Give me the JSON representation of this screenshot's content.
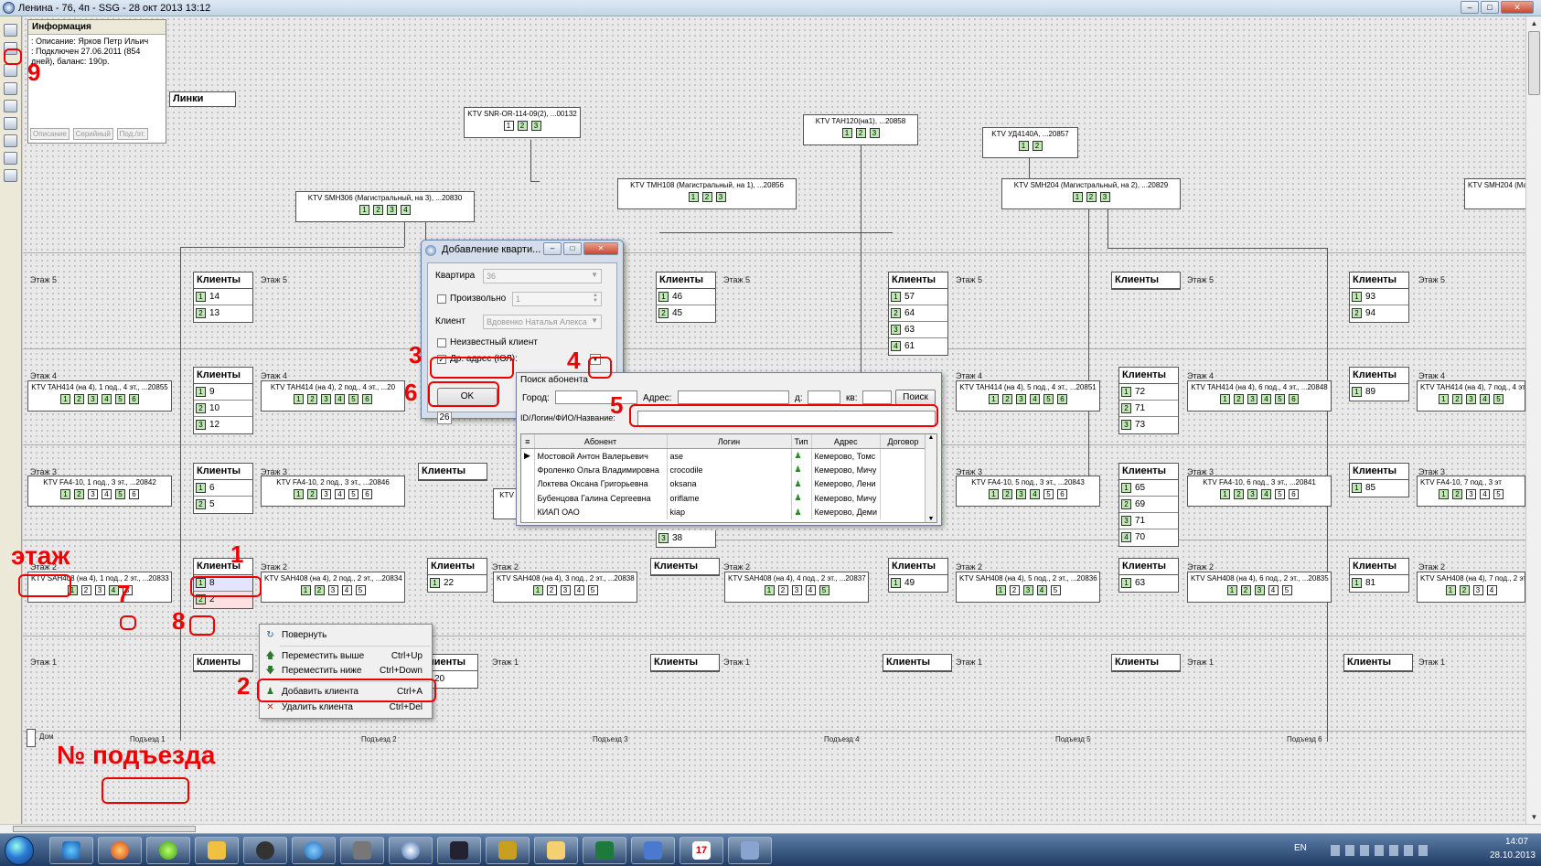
{
  "window": {
    "title": "Ленина - 76, 4п - SSG - 28 окт 2013 13:12"
  },
  "info_panel": {
    "title": "Информация",
    "lines": [
      ": Описание: Ярков Петр Ильич",
      ": Подключен 27.06.2011 (854",
      "дней), баланс: 190р."
    ],
    "buttons": [
      "Описание",
      "Серийный",
      "Под./эт."
    ]
  },
  "links_label": "Линки",
  "floors": {
    "f5": "Этаж 5",
    "f4": "Этаж 4",
    "f3": "Этаж 3",
    "f2": "Этаж 2",
    "f1": "Этаж 1"
  },
  "clients_header": "Клиенты",
  "home_label": "Дом",
  "entrances": [
    "Подъезд 1",
    "Подъезд 2",
    "Подъезд 3",
    "Подъезд 4",
    "Подъезд 5",
    "Подъезд 6"
  ],
  "main_devices": [
    {
      "label": "KTV SNR-OR-114-09(2), ...00132",
      "ports": [
        "1",
        "2",
        "3"
      ]
    },
    {
      "label": "KTV TAH120(на1), ...20858",
      "ports": [
        "1",
        "2",
        "3"
      ]
    },
    {
      "label": "KTV УД4140А, ...20857",
      "ports": [
        "1",
        "2"
      ]
    },
    {
      "label": "KTV SMH306 (Магистральный, на 3), ...20830",
      "ports": [
        "1",
        "2",
        "3",
        "4"
      ]
    },
    {
      "label": "KTV TMH108 (Магистральный, на 1), ...20856",
      "ports": [
        "1",
        "2",
        "3"
      ]
    },
    {
      "label": "KTV SMH204 (Магистральный, на 2), ...20829",
      "ports": [
        "1",
        "2",
        "3"
      ]
    },
    {
      "label": "KTV SMH204 (Ма",
      "ports": []
    }
  ],
  "floor_devices": {
    "f4": [
      {
        "label": "KTV TAH414 (на 4), 1 под., 4 эт., ...20855",
        "ports": [
          "1",
          "2",
          "3",
          "4",
          "5",
          "6"
        ]
      },
      {
        "label": "KTV TAH414 (на 4), 2 под., 4 эт., ...20",
        "ports": [
          "1",
          "2",
          "3",
          "4",
          "5",
          "6"
        ]
      },
      {
        "label": "KTV TAH414 (на 4), 5 под., 4 эт., ...20851",
        "ports": [
          "1",
          "2",
          "3",
          "4",
          "5",
          "6"
        ]
      },
      {
        "label": "KTV TAH414 (на 4), 6 под., 4 эт., ...20848",
        "ports": [
          "1",
          "2",
          "3",
          "4",
          "5",
          "6"
        ]
      },
      {
        "label": "KTV TAH414 (на 4), 7 под., 4 эт",
        "ports": [
          "1",
          "2",
          "3",
          "4",
          "5"
        ]
      }
    ],
    "f3": [
      {
        "label": "KTV FA4-10, 1 под., 3 эт., ...20842",
        "ports": [
          "1",
          "2",
          "3",
          "4",
          "5",
          "6"
        ]
      },
      {
        "label": "KTV FA4-10, 2 под., 3 эт., ...20846",
        "ports": [
          "1",
          "2",
          "3",
          "4",
          "5",
          "6"
        ]
      },
      {
        "label": "KTV",
        "ports": []
      },
      {
        "label": "KTV FA4-10, 5 под., 3 эт., ...20843",
        "ports": [
          "1",
          "2",
          "3",
          "4",
          "5",
          "6"
        ]
      },
      {
        "label": "KTV FA4-10, 6 под., 3 эт., ...20841",
        "ports": [
          "1",
          "2",
          "3",
          "4",
          "5",
          "6"
        ]
      },
      {
        "label": "KTV FA4-10, 7 под., 3 эт",
        "ports": [
          "1",
          "2",
          "3",
          "4",
          "5"
        ]
      }
    ],
    "f2": [
      {
        "label": "KTV SAH408 (на 4), 1 под., 2 эт., ...20833",
        "ports": [
          "1",
          "2",
          "3",
          "4",
          "5"
        ]
      },
      {
        "label": "KTV SAH408 (на 4), 2 под., 2 эт., ...20834",
        "ports": [
          "1",
          "2",
          "3",
          "4",
          "5"
        ]
      },
      {
        "label": "KTV SAH408 (на 4), 3 под., 2 эт., ...20838",
        "ports": [
          "1",
          "2",
          "3",
          "4",
          "5"
        ]
      },
      {
        "label": "KTV SAH408 (на 4), 4 под., 2 эт., ...20837",
        "ports": [
          "1",
          "2",
          "3",
          "4",
          "5"
        ]
      },
      {
        "label": "KTV SAH408 (на 4), 5 под., 2 эт., ...20836",
        "ports": [
          "1",
          "2",
          "3",
          "4",
          "5"
        ]
      },
      {
        "label": "KTV SAH408 (на 4), 6 под., 2 эт., ...20835",
        "ports": [
          "1",
          "2",
          "3",
          "4",
          "5"
        ]
      },
      {
        "label": "KTV SAH408 (на 4), 7 под., 2 эт",
        "ports": [
          "1",
          "2",
          "3",
          "4"
        ]
      }
    ]
  },
  "client_boxes": {
    "e1f5": [
      [
        "1",
        "14"
      ],
      [
        "2",
        "13"
      ]
    ],
    "e1f4": [
      [
        "1",
        "9"
      ],
      [
        "2",
        "10"
      ],
      [
        "3",
        "12"
      ]
    ],
    "e1f3": [
      [
        "1",
        "6"
      ],
      [
        "2",
        "5"
      ]
    ],
    "e1f2": [
      [
        "1",
        "8"
      ],
      [
        "2",
        "2"
      ]
    ],
    "e2f3": [],
    "e2f1": [],
    "e3f5": [
      [
        "1",
        "46"
      ],
      [
        "2",
        "45"
      ]
    ],
    "e3f3": [
      [
        "3",
        "38"
      ]
    ],
    "e3f2": [
      [
        "1",
        "22"
      ]
    ],
    "e3f1": [
      [
        "1",
        "20"
      ]
    ],
    "e4f5": [
      [
        "1",
        "57"
      ],
      [
        "2",
        "64"
      ],
      [
        "3",
        "63"
      ],
      [
        "4",
        "61"
      ]
    ],
    "e4f2": [],
    "e4f1": [],
    "e5f2": [
      [
        "1",
        "49"
      ]
    ],
    "e5f1": [],
    "e6f5": [],
    "e6f4": [
      [
        "1",
        "72"
      ],
      [
        "2",
        "71"
      ],
      [
        "3",
        "73"
      ]
    ],
    "e6f3": [
      [
        "1",
        "65"
      ],
      [
        "2",
        "69"
      ],
      [
        "3",
        "71"
      ],
      [
        "4",
        "70"
      ]
    ],
    "e6f2": [
      [
        "1",
        "63"
      ]
    ],
    "e6f1": [],
    "e7f5": [
      [
        "1",
        "93"
      ],
      [
        "2",
        "94"
      ]
    ],
    "e7f4": [
      [
        "1",
        "89"
      ]
    ],
    "e7f3": [
      [
        "1",
        "85"
      ]
    ],
    "e7f2": [
      [
        "1",
        "81"
      ]
    ],
    "e7f1": []
  },
  "dialog": {
    "title": "Добавление кварти...",
    "apartment_label": "Квартира",
    "apartment_value": "36",
    "arbitrary_label": "Произвольно",
    "arbitrary_value": "1",
    "client_label": "Клиент",
    "client_value": "Вдовенко Наталья Алекса",
    "unknown_label": "Неизвестный клиент",
    "other_address_label": "Др. адрес (ЮЛ):",
    "ok_label": "OK",
    "behind_value": "26"
  },
  "search": {
    "title": "Поиск абонента",
    "city_label": "Город:",
    "address_label": "Адрес:",
    "house_label": "д:",
    "apt_label": "кв:",
    "search_button": "Поиск",
    "id_label": "ID/Логин/ФИО/Название:",
    "columns": [
      "Абонент",
      "Логин",
      "Тип",
      "Адрес",
      "Договор"
    ],
    "rows": [
      {
        "name": "Мостовой Антон Валерьевич",
        "login": "ase",
        "addr": "Кемерово, Томс"
      },
      {
        "name": "Фроленко Ольга Владимировна",
        "login": "crocodile",
        "addr": "Кемерово, Мичу"
      },
      {
        "name": "Локтева Оксана Григорьевна",
        "login": "oksana",
        "addr": "Кемерово, Лени"
      },
      {
        "name": "Бубенцова Галина Сергеевна",
        "login": "oriflame",
        "addr": "Кемерово, Мичу"
      },
      {
        "name": "КИАП ОАО",
        "login": "kiap",
        "addr": "Кемерово, Деми"
      }
    ]
  },
  "context_menu": [
    {
      "label": "Повернуть",
      "shortcut": "",
      "icon": "rotate-icon"
    },
    {
      "label": "Переместить выше",
      "shortcut": "Ctrl+Up",
      "icon": "arrow-up-icon"
    },
    {
      "label": "Переместить ниже",
      "shortcut": "Ctrl+Down",
      "icon": "arrow-down-icon"
    },
    {
      "label": "Добавить клиента",
      "shortcut": "Ctrl+A",
      "icon": "user-add-icon"
    },
    {
      "label": "Удалить клиента",
      "shortcut": "Ctrl+Del",
      "icon": "delete-icon"
    }
  ],
  "annotations": {
    "n1": "1",
    "n2": "2",
    "n3": "3",
    "n4": "4",
    "n5": "5",
    "n6": "6",
    "n7": "7",
    "n8": "8",
    "n9": "9",
    "floor_word": "этаж",
    "entrance_word": "№ подъезда",
    "color": "#e00000"
  },
  "taskbar": {
    "lang": "EN",
    "time": "14:07",
    "date": "28.10.2013",
    "calendar_day": "17"
  }
}
